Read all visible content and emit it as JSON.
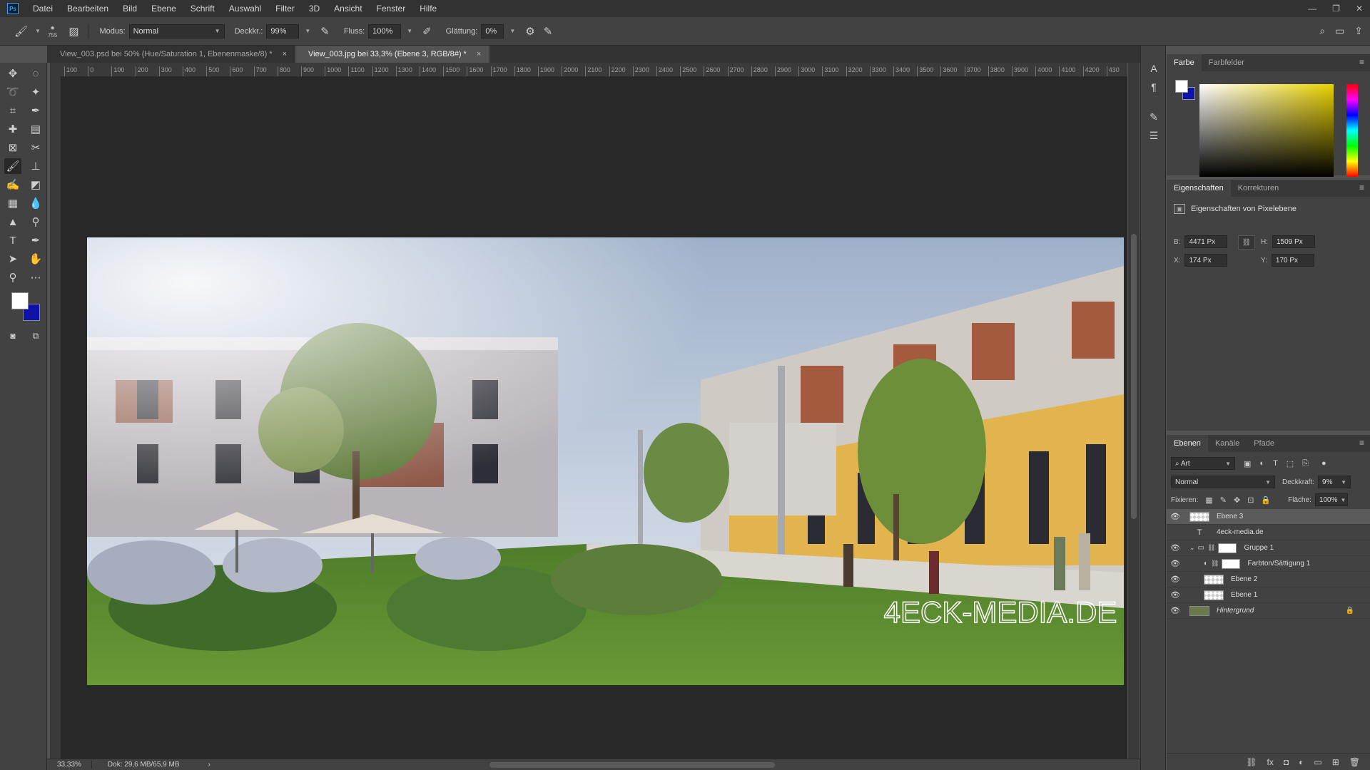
{
  "app": {
    "logo": "Ps"
  },
  "menu": [
    "Datei",
    "Bearbeiten",
    "Bild",
    "Ebene",
    "Schrift",
    "Auswahl",
    "Filter",
    "3D",
    "Ansicht",
    "Fenster",
    "Hilfe"
  ],
  "window_controls": {
    "minimize": "—",
    "restore": "❐",
    "close": "✕"
  },
  "options": {
    "brush_size": "755",
    "mode_label": "Modus:",
    "mode_value": "Normal",
    "opacity_label": "Deckkr.:",
    "opacity_value": "99%",
    "flow_label": "Fluss:",
    "flow_value": "100%",
    "smoothing_label": "Glättung:",
    "smoothing_value": "0%"
  },
  "tabs": [
    {
      "label": "View_003.psd bei 50% (Hue/Saturation 1, Ebenenmaske/8) *",
      "close": "×"
    },
    {
      "label": "View_003.jpg bei 33,3% (Ebene 3, RGB/8#) *",
      "close": "×"
    }
  ],
  "ruler_ticks": [
    "100",
    "0",
    "100",
    "200",
    "300",
    "400",
    "500",
    "600",
    "700",
    "800",
    "900",
    "1000",
    "1100",
    "1200",
    "1300",
    "1400",
    "1500",
    "1600",
    "1700",
    "1800",
    "1900",
    "2000",
    "2100",
    "2200",
    "2300",
    "2400",
    "2500",
    "2600",
    "2700",
    "2800",
    "2900",
    "3000",
    "3100",
    "3200",
    "3300",
    "3400",
    "3500",
    "3600",
    "3700",
    "3800",
    "3900",
    "4000",
    "4100",
    "4200",
    "430"
  ],
  "image": {
    "watermark": "4ECK-MEDIA.DE",
    "sky_color": "#b8c6dc",
    "grass_color": "#5b8a2f"
  },
  "status": {
    "zoom": "33,33%",
    "doc": "Dok: 29,6 MB/65,9 MB"
  },
  "color_panel": {
    "tabs": [
      "Farbe",
      "Farbfelder"
    ],
    "fg_color": "#ffffff",
    "bg_color": "#0f12a8"
  },
  "props_panel": {
    "tabs": [
      "Eigenschaften",
      "Korrekturen"
    ],
    "title": "Eigenschaften von Pixelebene",
    "w_label": "B:",
    "w_value": "4471 Px",
    "h_label": "H:",
    "h_value": "1509 Px",
    "x_label": "X:",
    "x_value": "174 Px",
    "y_label": "Y:",
    "y_value": "170 Px"
  },
  "layers_panel": {
    "tabs": [
      "Ebenen",
      "Kanäle",
      "Pfade"
    ],
    "filter_kind": "Art",
    "blend_mode": "Normal",
    "opacity_label": "Deckkraft:",
    "opacity_value": "9%",
    "lock_label": "Fixieren:",
    "fill_label": "Fläche:",
    "fill_value": "100%",
    "layers": [
      {
        "name": "Ebene 3",
        "type": "pixel",
        "visible": true,
        "selected": true
      },
      {
        "name": "4eck-media.de",
        "type": "text",
        "visible": false
      },
      {
        "name": "Gruppe 1",
        "type": "group",
        "visible": true
      },
      {
        "name": "Farbton/Sättigung 1",
        "type": "adjustment",
        "visible": true
      },
      {
        "name": "Ebene 2",
        "type": "pixel",
        "visible": true
      },
      {
        "name": "Ebene 1",
        "type": "pixel",
        "visible": true
      },
      {
        "name": "Hintergrund",
        "type": "background",
        "visible": true
      }
    ]
  }
}
